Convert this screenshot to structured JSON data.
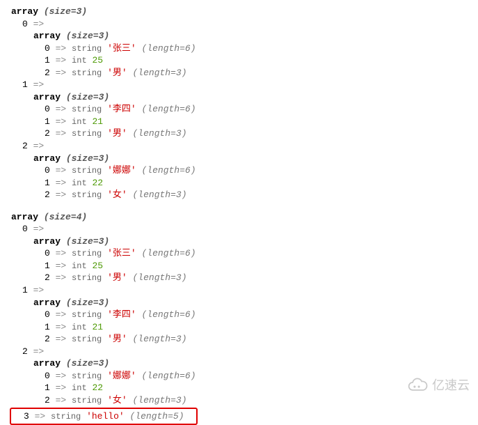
{
  "blocks": [
    {
      "size": 3,
      "items": [
        {
          "key": "0",
          "type": "array",
          "size": 3,
          "children": [
            {
              "key": "0",
              "type": "string",
              "value": "张三",
              "length": 6
            },
            {
              "key": "1",
              "type": "int",
              "value": "25"
            },
            {
              "key": "2",
              "type": "string",
              "value": "男",
              "length": 3
            }
          ]
        },
        {
          "key": "1",
          "type": "array",
          "size": 3,
          "children": [
            {
              "key": "0",
              "type": "string",
              "value": "李四",
              "length": 6
            },
            {
              "key": "1",
              "type": "int",
              "value": "21"
            },
            {
              "key": "2",
              "type": "string",
              "value": "男",
              "length": 3
            }
          ]
        },
        {
          "key": "2",
          "type": "array",
          "size": 3,
          "children": [
            {
              "key": "0",
              "type": "string",
              "value": "娜娜",
              "length": 6
            },
            {
              "key": "1",
              "type": "int",
              "value": "22"
            },
            {
              "key": "2",
              "type": "string",
              "value": "女",
              "length": 3
            }
          ]
        }
      ]
    },
    {
      "size": 4,
      "items": [
        {
          "key": "0",
          "type": "array",
          "size": 3,
          "children": [
            {
              "key": "0",
              "type": "string",
              "value": "张三",
              "length": 6
            },
            {
              "key": "1",
              "type": "int",
              "value": "25"
            },
            {
              "key": "2",
              "type": "string",
              "value": "男",
              "length": 3
            }
          ]
        },
        {
          "key": "1",
          "type": "array",
          "size": 3,
          "children": [
            {
              "key": "0",
              "type": "string",
              "value": "李四",
              "length": 6
            },
            {
              "key": "1",
              "type": "int",
              "value": "21"
            },
            {
              "key": "2",
              "type": "string",
              "value": "男",
              "length": 3
            }
          ]
        },
        {
          "key": "2",
          "type": "array",
          "size": 3,
          "children": [
            {
              "key": "0",
              "type": "string",
              "value": "娜娜",
              "length": 6
            },
            {
              "key": "1",
              "type": "int",
              "value": "22"
            },
            {
              "key": "2",
              "type": "string",
              "value": "女",
              "length": 3
            }
          ]
        },
        {
          "key": "3",
          "type": "string",
          "value": "hello",
          "length": 5,
          "highlighted": true
        }
      ]
    }
  ],
  "labels": {
    "array": "array",
    "string": "string",
    "int": "int",
    "size_prefix": "(size=",
    "size_suffix": ")",
    "length_prefix": "(length=",
    "length_suffix": ")",
    "arrow": "=>"
  },
  "watermark": "亿速云"
}
